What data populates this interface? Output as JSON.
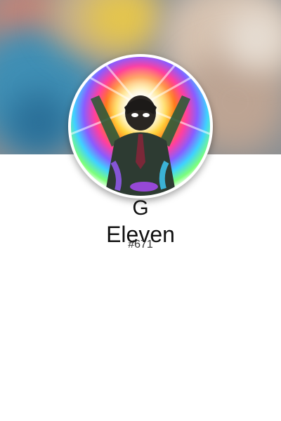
{
  "profile": {
    "name_line1": "G",
    "name_line2": "Eleven",
    "discriminator": "#671"
  },
  "colors": {
    "background": "#ffffff",
    "avatar_border": "#ffffff",
    "text": "#111111"
  }
}
